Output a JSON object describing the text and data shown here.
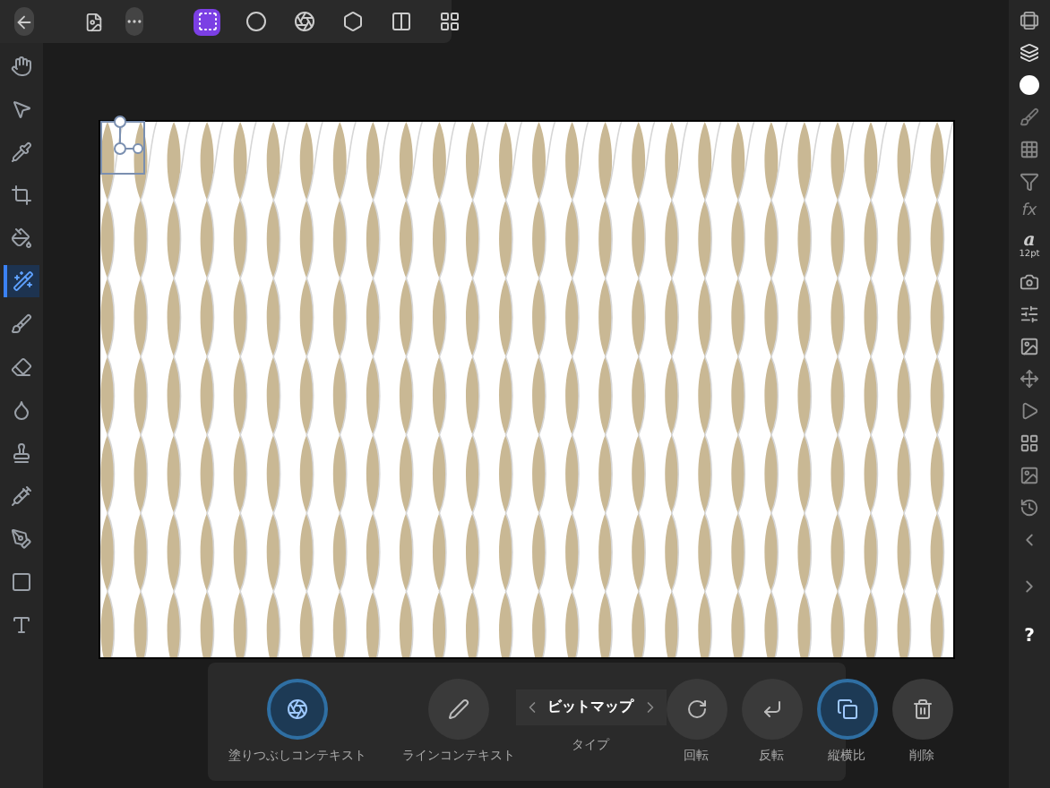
{
  "personas": [
    {
      "selected": true
    },
    {
      "selected": false
    },
    {
      "selected": false
    },
    {
      "selected": false
    },
    {
      "selected": false
    },
    {
      "selected": false
    }
  ],
  "tools": [
    {
      "selected": false
    },
    {
      "selected": false
    },
    {
      "selected": false
    },
    {
      "selected": false
    },
    {
      "selected": false
    },
    {
      "selected": true
    },
    {
      "selected": false
    },
    {
      "selected": false
    },
    {
      "selected": false
    },
    {
      "selected": false
    },
    {
      "selected": false
    },
    {
      "selected": false
    },
    {
      "selected": false
    },
    {
      "selected": false
    }
  ],
  "right_toolbar": {
    "fx_glyph": "fx",
    "text_glyph": "a",
    "text_size": "12pt",
    "help": "?"
  },
  "context_toolbar": {
    "left_buttons": [
      {
        "label": "塗りつぶしコンテキスト",
        "selected": true
      },
      {
        "label": "ラインコンテキスト",
        "selected": false
      }
    ],
    "type_selector": {
      "value": "ビットマップ",
      "label": "タイプ"
    },
    "right_buttons": [
      {
        "label": "回転",
        "selected": false
      },
      {
        "label": "反転",
        "selected": false
      },
      {
        "label": "縦横比",
        "selected": true
      },
      {
        "label": "削除",
        "selected": false
      }
    ]
  }
}
